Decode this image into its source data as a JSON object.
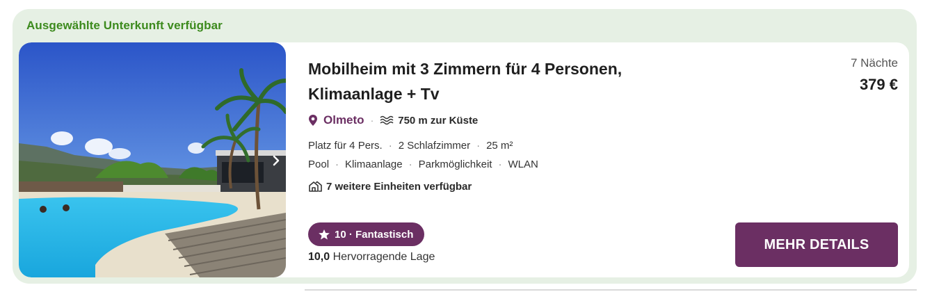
{
  "featured_label": "Ausgewählte Unterkunft verfügbar",
  "listing": {
    "title_line1": "Mobilheim mit 3 Zimmern für 4 Personen,",
    "title_line2": "Klimaanlage + Tv",
    "location": "Olmeto",
    "coast_distance": "750 m zur Küste",
    "facts": [
      "Platz für 4 Pers.",
      "2 Schlafzimmer",
      "25 m²"
    ],
    "amenities": [
      "Pool",
      "Klimaanlage",
      "Parkmöglichkeit",
      "WLAN"
    ],
    "more_units": "7 weitere Einheiten verfügbar",
    "rating_badge": "10 · Fantastisch",
    "rating_score": "10,0",
    "rating_sub": "Hervorragende Lage",
    "nights": "7 Nächte",
    "price": "379 €",
    "details_button": "MEHR DETAILS"
  },
  "icons": {
    "location": "map-pin-icon",
    "coast": "waves-icon",
    "units": "houses-icon",
    "rating": "star-icon",
    "photo_next": "chevron-right-icon"
  },
  "colors": {
    "accent": "#6b2f63",
    "featured_green": "#3c8a1d",
    "card_bg": "#e6f0e4"
  }
}
